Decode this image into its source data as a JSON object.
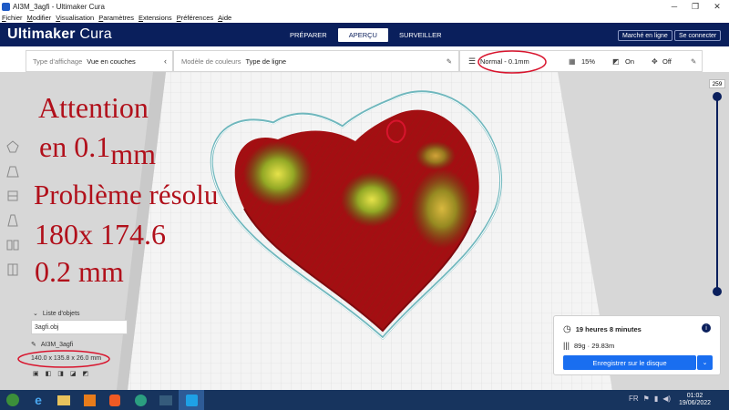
{
  "window": {
    "title": "AI3M_3agfi - Ultimaker Cura"
  },
  "menu": [
    "Fichier",
    "Modifier",
    "Visualisation",
    "Paramètres",
    "Extensions",
    "Préférences",
    "Aide"
  ],
  "header": {
    "brand_bold": "Ultimaker",
    "brand_light": "Cura",
    "stages": [
      "PRÉPARER",
      "APERÇU",
      "SURVEILLER"
    ],
    "active_stage": "APERÇU",
    "marketplace": "Marché en ligne",
    "signin": "Se connecter"
  },
  "view_toolbar": {
    "view_type_label": "Type d'affichage",
    "view_type_value": "Vue en couches",
    "color_model_label": "Modèle de couleurs",
    "color_model_value": "Type de ligne"
  },
  "print_settings": {
    "profile": "Normal - 0.1mm",
    "infill": "15%",
    "support": "On",
    "adhesion": "Off"
  },
  "layer_slider": {
    "max_value": "259",
    "level_fraction": 1.0
  },
  "annotations": {
    "line1": "Attention",
    "line2_a": "en 0.1",
    "line2_b": "mm",
    "line3": "Problème résolu",
    "line4": "180x 174.6",
    "line5": "0.2 mm"
  },
  "objects": {
    "list_label": "Liste d'objets",
    "file": "3agfi.obj",
    "object_name": "AI3M_3agfi",
    "dimensions": "140.0 x 135.8 x 26.0 mm"
  },
  "job": {
    "duration": "19 heures 8 minutes",
    "material": "89g · 29.83m",
    "save_button": "Enregistrer sur le disque"
  },
  "clock": {
    "time": "01:02",
    "date": "19/06/2022"
  },
  "colors": {
    "header": "#0a1f5c",
    "accent": "#196ef0",
    "annotation_red": "#b1101b"
  }
}
